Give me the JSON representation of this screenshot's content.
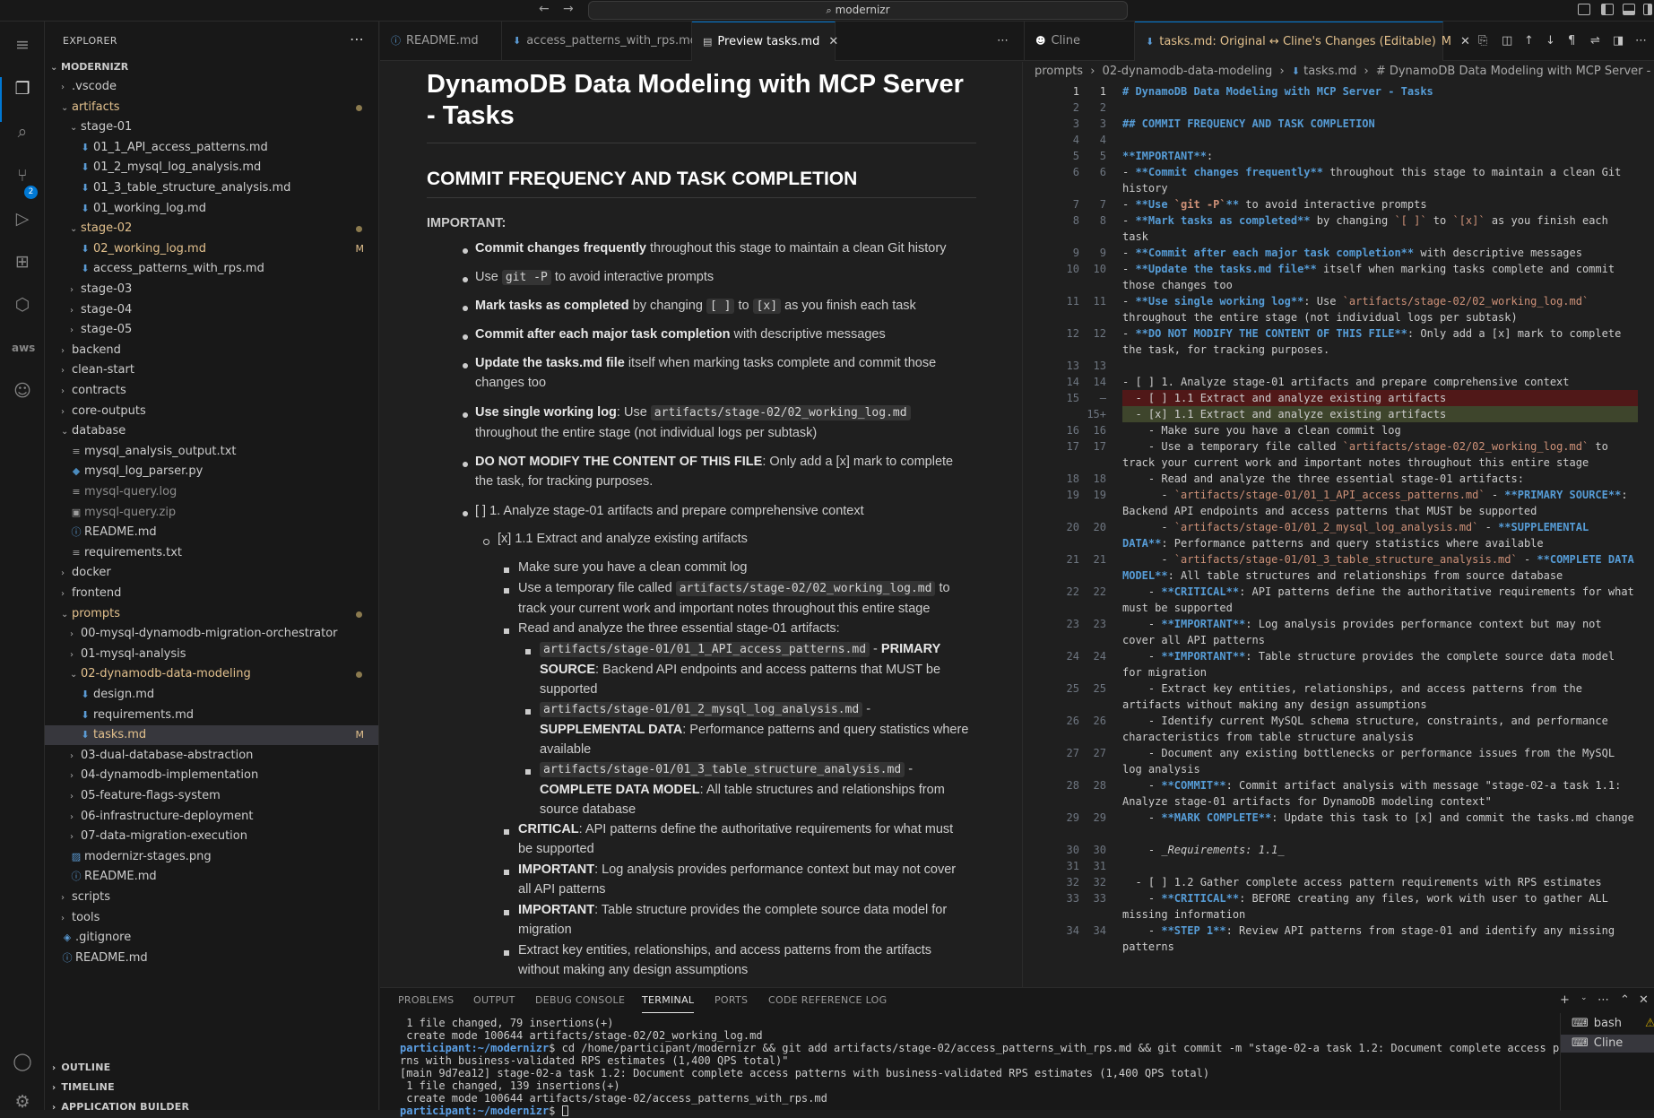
{
  "titlebar": {
    "search": "modernizr",
    "back": "←",
    "forward": "→"
  },
  "sidebar": {
    "title": "EXPLORER",
    "root": "MODERNIZR",
    "tree": [
      {
        "label": ".vscode",
        "depth": 1,
        "type": "folder",
        "open": false
      },
      {
        "label": "artifacts",
        "depth": 1,
        "type": "folder",
        "open": true,
        "color": "mod",
        "dot": true
      },
      {
        "label": "stage-01",
        "depth": 2,
        "type": "folder",
        "open": true
      },
      {
        "label": "01_1_API_access_patterns.md",
        "depth": 3,
        "type": "md"
      },
      {
        "label": "01_2_mysql_log_analysis.md",
        "depth": 3,
        "type": "md"
      },
      {
        "label": "01_3_table_structure_analysis.md",
        "depth": 3,
        "type": "md"
      },
      {
        "label": "01_working_log.md",
        "depth": 3,
        "type": "md"
      },
      {
        "label": "stage-02",
        "depth": 2,
        "type": "folder",
        "open": true,
        "color": "mod",
        "dot": true
      },
      {
        "label": "02_working_log.md",
        "depth": 3,
        "type": "md",
        "color": "mod",
        "mark": "M"
      },
      {
        "label": "access_patterns_with_rps.md",
        "depth": 3,
        "type": "md"
      },
      {
        "label": "stage-03",
        "depth": 2,
        "type": "folder",
        "open": false
      },
      {
        "label": "stage-04",
        "depth": 2,
        "type": "folder",
        "open": false
      },
      {
        "label": "stage-05",
        "depth": 2,
        "type": "folder",
        "open": false
      },
      {
        "label": "backend",
        "depth": 1,
        "type": "folder",
        "open": false
      },
      {
        "label": "clean-start",
        "depth": 1,
        "type": "folder",
        "open": false
      },
      {
        "label": "contracts",
        "depth": 1,
        "type": "folder",
        "open": false
      },
      {
        "label": "core-outputs",
        "depth": 1,
        "type": "folder",
        "open": false
      },
      {
        "label": "database",
        "depth": 1,
        "type": "folder",
        "open": true
      },
      {
        "label": "mysql_analysis_output.txt",
        "depth": 2,
        "type": "txt"
      },
      {
        "label": "mysql_log_parser.py",
        "depth": 2,
        "type": "py"
      },
      {
        "label": "mysql-query.log",
        "depth": 2,
        "type": "log",
        "color": "dim"
      },
      {
        "label": "mysql-query.zip",
        "depth": 2,
        "type": "zip",
        "color": "dim"
      },
      {
        "label": "README.md",
        "depth": 2,
        "type": "info"
      },
      {
        "label": "requirements.txt",
        "depth": 2,
        "type": "txt"
      },
      {
        "label": "docker",
        "depth": 1,
        "type": "folder",
        "open": false
      },
      {
        "label": "frontend",
        "depth": 1,
        "type": "folder",
        "open": false
      },
      {
        "label": "prompts",
        "depth": 1,
        "type": "folder",
        "open": true,
        "color": "mod",
        "dot": true
      },
      {
        "label": "00-mysql-dynamodb-migration-orchestrator",
        "depth": 2,
        "type": "folder",
        "open": false
      },
      {
        "label": "01-mysql-analysis",
        "depth": 2,
        "type": "folder",
        "open": false
      },
      {
        "label": "02-dynamodb-data-modeling",
        "depth": 2,
        "type": "folder",
        "open": true,
        "color": "mod",
        "dot": true
      },
      {
        "label": "design.md",
        "depth": 3,
        "type": "md"
      },
      {
        "label": "requirements.md",
        "depth": 3,
        "type": "md"
      },
      {
        "label": "tasks.md",
        "depth": 3,
        "type": "md",
        "color": "mod",
        "mark": "M",
        "selected": true
      },
      {
        "label": "03-dual-database-abstraction",
        "depth": 2,
        "type": "folder",
        "open": false
      },
      {
        "label": "04-dynamodb-implementation",
        "depth": 2,
        "type": "folder",
        "open": false
      },
      {
        "label": "05-feature-flags-system",
        "depth": 2,
        "type": "folder",
        "open": false
      },
      {
        "label": "06-infrastructure-deployment",
        "depth": 2,
        "type": "folder",
        "open": false
      },
      {
        "label": "07-data-migration-execution",
        "depth": 2,
        "type": "folder",
        "open": false
      },
      {
        "label": "modernizr-stages.png",
        "depth": 2,
        "type": "img"
      },
      {
        "label": "README.md",
        "depth": 2,
        "type": "info"
      },
      {
        "label": "scripts",
        "depth": 1,
        "type": "folder",
        "open": false
      },
      {
        "label": "tools",
        "depth": 1,
        "type": "folder",
        "open": false
      },
      {
        "label": ".gitignore",
        "depth": 1,
        "type": "git"
      },
      {
        "label": "README.md",
        "depth": 1,
        "type": "info"
      }
    ],
    "sections": [
      "OUTLINE",
      "TIMELINE",
      "APPLICATION BUILDER"
    ]
  },
  "tabs_left": [
    {
      "label": "README.md",
      "icon": "info"
    },
    {
      "label": "access_patterns_with_rps.md",
      "icon": "md"
    },
    {
      "label": "Preview tasks.md",
      "icon": "preview",
      "active": true
    }
  ],
  "tabs_right": [
    {
      "label": "Cline",
      "icon": "cline"
    },
    {
      "label": "tasks.md: Original ↔ Cline's Changes (Editable)",
      "icon": "md",
      "active": true,
      "mark": "M"
    }
  ],
  "preview": {
    "h1": "DynamoDB Data Modeling with MCP Server - Tasks",
    "h2": "COMMIT FREQUENCY AND TASK COMPLETION",
    "important": "IMPORTANT:",
    "b1_bold": "Commit changes frequently",
    "b1_rest": " throughout this stage to maintain a clean Git history",
    "b2_pre": "Use ",
    "b2_code": "git -P",
    "b2_rest": " to avoid interactive prompts",
    "b3_bold": "Mark tasks as completed",
    "b3_mid": " by changing ",
    "b3_c1": "[ ]",
    "b3_to": " to ",
    "b3_c2": "[x]",
    "b3_rest": " as you finish each task",
    "b4_bold": "Commit after each major task completion",
    "b4_rest": " with descriptive messages",
    "b5_bold": "Update the tasks.md file",
    "b5_rest": " itself when marking tasks complete and commit those changes too",
    "b6_bold": "Use single working log",
    "b6_mid": ": Use ",
    "b6_code": "artifacts/stage-02/02_working_log.md",
    "b6_rest": " throughout the entire stage (not individual logs per subtask)",
    "b7_bold": "DO NOT MODIFY THE CONTENT OF THIS FILE",
    "b7_rest": ": Only add a [x] mark to complete the task, for tracking purposes.",
    "task1": "[ ] 1. Analyze stage-01 artifacts and prepare comprehensive context",
    "task11": "[x] 1.1 Extract and analyze existing artifacts",
    "s1": "Make sure you have a clean commit log",
    "s2_pre": "Use a temporary file called ",
    "s2_code": "artifacts/stage-02/02_working_log.md",
    "s2_rest": " to track your current work and important notes throughout this entire stage",
    "s3": "Read and analyze the three essential stage-01 artifacts:",
    "a1_code": "artifacts/stage-01/01_1_API_access_patterns.md",
    "a1_bold": "PRIMARY SOURCE",
    "a1_rest": ": Backend API endpoints and access patterns that MUST be supported",
    "a2_code": "artifacts/stage-01/01_2_mysql_log_analysis.md",
    "a2_bold": "SUPPLEMENTAL DATA",
    "a2_rest": ": Performance patterns and query statistics where available",
    "a3_code": "artifacts/stage-01/01_3_table_structure_analysis.md",
    "a3_bold": "COMPLETE DATA MODEL",
    "a3_rest": ": All table structures and relationships from source database",
    "s4_bold": "CRITICAL",
    "s4_rest": ": API patterns define the authoritative requirements for what must be supported",
    "s5_bold": "IMPORTANT",
    "s5_rest": ": Log analysis provides performance context but may not cover all API patterns",
    "s6_bold": "IMPORTANT",
    "s6_rest": ": Table structure provides the complete source data model for migration",
    "s7": "Extract key entities, relationships, and access patterns from the artifacts without making any design assumptions",
    "dash": " - "
  },
  "breadcrumbs": [
    "prompts",
    "02-dynamodb-data-modeling",
    "tasks.md",
    "# DynamoDB Data Modeling with MCP Server - Tasks"
  ],
  "diff_lines": [
    {
      "l": "1",
      "r": "1",
      "text": "# DynamoDB Data Modeling with MCP Server - Tasks"
    },
    {
      "l": "2",
      "r": "2",
      "text": ""
    },
    {
      "l": "3",
      "r": "3",
      "text": "## COMMIT FREQUENCY AND TASK COMPLETION"
    },
    {
      "l": "4",
      "r": "4",
      "text": ""
    },
    {
      "l": "5",
      "r": "5",
      "text": "**IMPORTANT**:"
    },
    {
      "l": "6",
      "r": "6",
      "text": "- **Commit changes frequently** throughout this stage to maintain a clean Git history"
    },
    {
      "l": "7",
      "r": "7",
      "text": "- **Use `git -P`** to avoid interactive prompts"
    },
    {
      "l": "8",
      "r": "8",
      "text": "- **Mark tasks as completed** by changing `[ ]` to `[x]` as you finish each task"
    },
    {
      "l": "9",
      "r": "9",
      "text": "- **Commit after each major task completion** with descriptive messages"
    },
    {
      "l": "10",
      "r": "10",
      "text": "- **Update the tasks.md file** itself when marking tasks complete and commit those changes too"
    },
    {
      "l": "11",
      "r": "11",
      "text": "- **Use single working log**: Use `artifacts/stage-02/02_working_log.md` throughout the entire stage (not individual logs per subtask)"
    },
    {
      "l": "12",
      "r": "12",
      "text": "- **DO NOT MODIFY THE CONTENT OF THIS FILE**: Only add a [x] mark to complete the task, for tracking purposes."
    },
    {
      "l": "13",
      "r": "13",
      "text": ""
    },
    {
      "l": "14",
      "r": "14",
      "text": "- [ ] 1. Analyze stage-01 artifacts and prepare comprehensive context"
    },
    {
      "l": "15",
      "r": "—",
      "text": "  - [ ] 1.1 Extract and analyze existing artifacts",
      "kind": "del"
    },
    {
      "l": "",
      "r": "15+",
      "text": "  - [x] 1.1 Extract and analyze existing artifacts",
      "kind": "add"
    },
    {
      "l": "16",
      "r": "16",
      "text": "    - Make sure you have a clean commit log"
    },
    {
      "l": "17",
      "r": "17",
      "text": "    - Use a temporary file called `artifacts/stage-02/02_working_log.md` to track your current work and important notes throughout this entire stage"
    },
    {
      "l": "18",
      "r": "18",
      "text": "    - Read and analyze the three essential stage-01 artifacts:"
    },
    {
      "l": "19",
      "r": "19",
      "text": "      - `artifacts/stage-01/01_1_API_access_patterns.md` - **PRIMARY SOURCE**: Backend API endpoints and access patterns that MUST be supported"
    },
    {
      "l": "20",
      "r": "20",
      "text": "      - `artifacts/stage-01/01_2_mysql_log_analysis.md` - **SUPPLEMENTAL DATA**: Performance patterns and query statistics where available"
    },
    {
      "l": "21",
      "r": "21",
      "text": "      - `artifacts/stage-01/01_3_table_structure_analysis.md` - **COMPLETE DATA MODEL**: All table structures and relationships from source database"
    },
    {
      "l": "22",
      "r": "22",
      "text": "    - **CRITICAL**: API patterns define the authoritative requirements for what must be supported"
    },
    {
      "l": "23",
      "r": "23",
      "text": "    - **IMPORTANT**: Log analysis provides performance context but may not cover all API patterns"
    },
    {
      "l": "24",
      "r": "24",
      "text": "    - **IMPORTANT**: Table structure provides the complete source data model for migration"
    },
    {
      "l": "25",
      "r": "25",
      "text": "    - Extract key entities, relationships, and access patterns from the artifacts without making any design assumptions"
    },
    {
      "l": "26",
      "r": "26",
      "text": "    - Identify current MySQL schema structure, constraints, and performance characteristics from table structure analysis"
    },
    {
      "l": "27",
      "r": "27",
      "text": "    - Document any existing bottlenecks or performance issues from the MySQL log analysis"
    },
    {
      "l": "28",
      "r": "28",
      "text": "    - **COMMIT**: Commit artifact analysis with message \"stage-02-a task 1.1: Analyze stage-01 artifacts for DynamoDB modeling context\""
    },
    {
      "l": "29",
      "r": "29",
      "text": "    - **MARK COMPLETE**: Update this task to [x] and commit the tasks.md change"
    },
    {
      "l": "30",
      "r": "30",
      "text": "    - _Requirements: 1.1_"
    },
    {
      "l": "31",
      "r": "31",
      "text": ""
    },
    {
      "l": "32",
      "r": "32",
      "text": "  - [ ] 1.2 Gather complete access pattern requirements with RPS estimates"
    },
    {
      "l": "33",
      "r": "33",
      "text": "    - **CRITICAL**: BEFORE creating any files, work with user to gather ALL missing information"
    },
    {
      "l": "34",
      "r": "34",
      "text": "    - **STEP 1**: Review API patterns from stage-01 and identify any missing patterns"
    }
  ],
  "panel": {
    "tabs": [
      "PROBLEMS",
      "OUTPUT",
      "DEBUG CONSOLE",
      "TERMINAL",
      "PORTS",
      "CODE REFERENCE LOG"
    ],
    "active_tab": "TERMINAL",
    "lines": [
      " 1 file changed, 79 insertions(+)",
      " create mode 100644 artifacts/stage-02/02_working_log.md",
      "$ cd /home/participant/modernizr && git add artifacts/stage-02/access_patterns_with_rps.md && git commit -m \"stage-02-a task 1.2: Document complete access patte",
      "rns with business-validated RPS estimates (1,400 QPS total)\"",
      "[main 9d7ea12] stage-02-a task 1.2: Document complete access patterns with business-validated RPS estimates (1,400 QPS total)",
      " 1 file changed, 139 insertions(+)",
      " create mode 100644 artifacts/stage-02/access_patterns_with_rps.md",
      "$ "
    ],
    "prompt": "participant:~/modernizr",
    "terminals": [
      "bash",
      "Cline"
    ]
  }
}
